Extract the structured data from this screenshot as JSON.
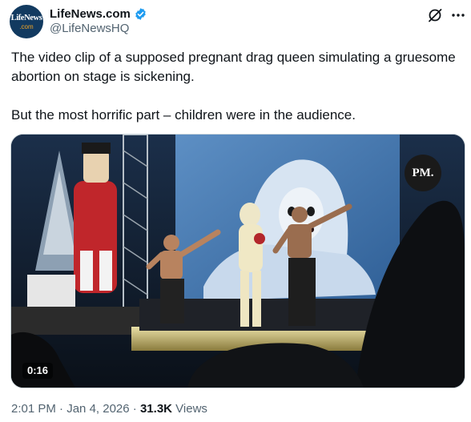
{
  "author": {
    "avatar_line1": "LifeNews",
    "avatar_line2": ".com",
    "name": "LifeNews.com",
    "handle": "@LifeNewsHQ"
  },
  "tweet": {
    "paragraphs": [
      "The video clip of a supposed pregnant drag queen simulating a gruesome abortion on stage is sickening.",
      "But the most horrific part – children were in the audience."
    ]
  },
  "media": {
    "watermark": "PM.",
    "duration": "0:16"
  },
  "meta": {
    "time": "2:01 PM",
    "separator": "·",
    "date": "Jan 4, 2026",
    "views_count": "31.3K",
    "views_label": "Views"
  },
  "icons": {
    "verified": "verified-badge-icon",
    "grok": "grok-icon",
    "more": "more-options-icon"
  },
  "colors": {
    "verified_blue": "#1d9bf0",
    "secondary_text": "#536471",
    "primary_text": "#0f1419"
  }
}
